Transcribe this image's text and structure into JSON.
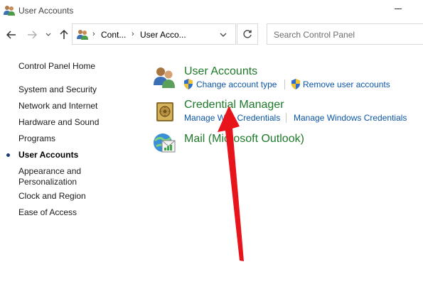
{
  "window": {
    "title": "User Accounts"
  },
  "navigation": {
    "breadcrumbs": [
      "Cont...",
      "User Acco..."
    ],
    "search_placeholder": "Search Control Panel"
  },
  "sidebar": {
    "home": "Control Panel Home",
    "items": [
      {
        "label": "System and Security",
        "active": false
      },
      {
        "label": "Network and Internet",
        "active": false
      },
      {
        "label": "Hardware and Sound",
        "active": false
      },
      {
        "label": "Programs",
        "active": false
      },
      {
        "label": "User Accounts",
        "active": true
      },
      {
        "label": "Appearance and Personalization",
        "active": false
      },
      {
        "label": "Clock and Region",
        "active": false
      },
      {
        "label": "Ease of Access",
        "active": false
      }
    ]
  },
  "categories": [
    {
      "title": "User Accounts",
      "icon": "users-icon",
      "links": [
        "Change account type",
        "Remove user accounts"
      ]
    },
    {
      "title": "Credential Manager",
      "icon": "vault-icon",
      "links": [
        "Manage Web Credentials",
        "Manage Windows Credentials"
      ]
    },
    {
      "title": "Mail (Microsoft Outlook)",
      "icon": "mail-icon",
      "links": []
    }
  ],
  "colors": {
    "category_title": "#1e7a2a",
    "link": "#0a56a8",
    "annotation_arrow": "#e8141b"
  }
}
